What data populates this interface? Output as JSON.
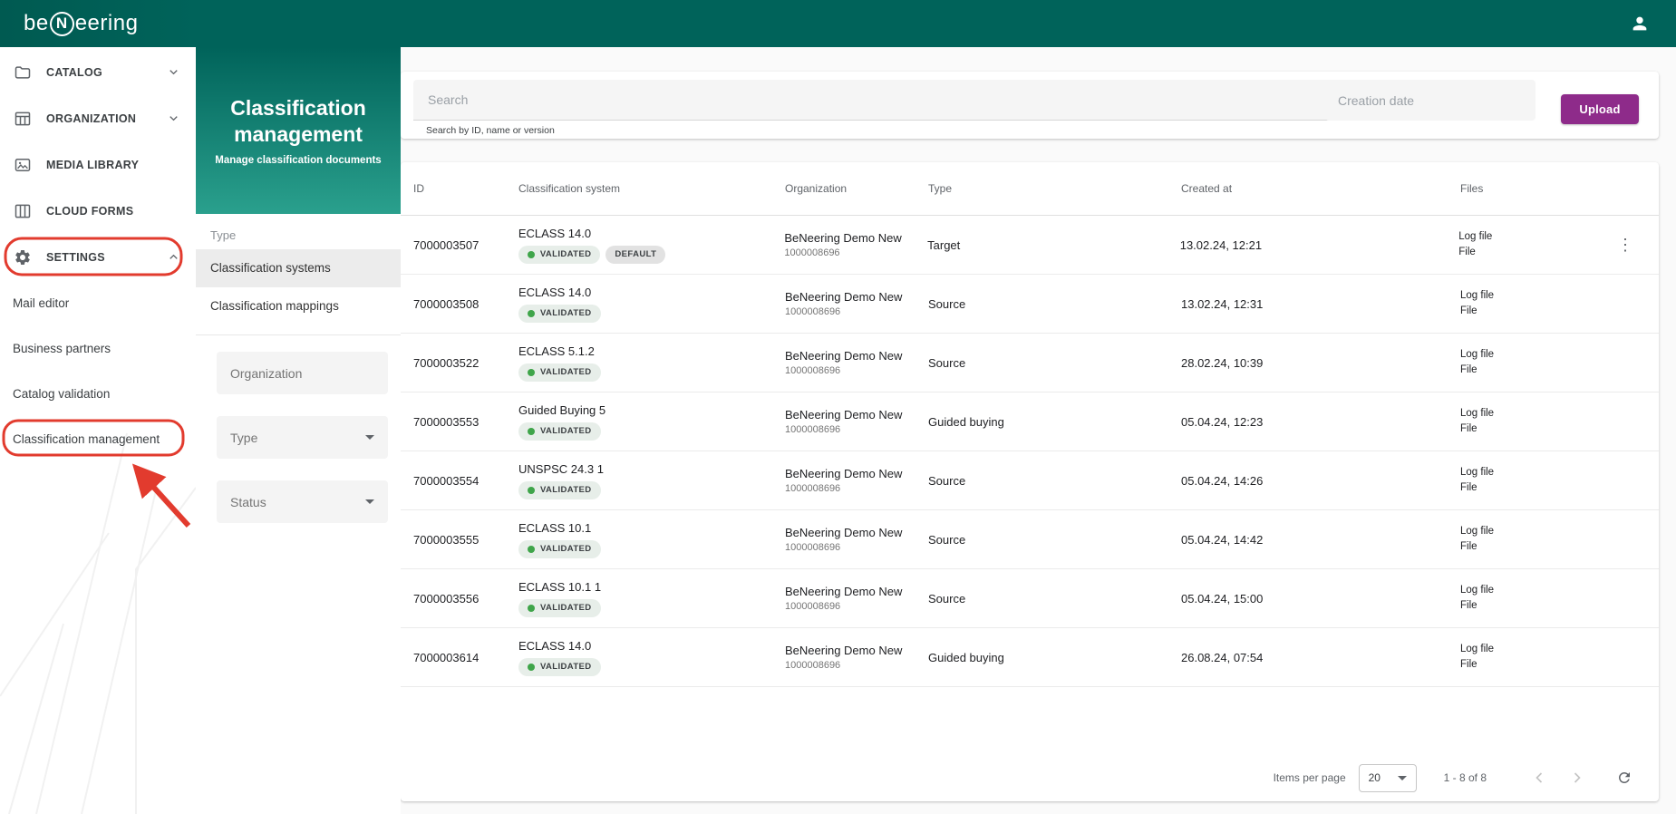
{
  "topbar": {
    "logo_prefix": "be",
    "logo_n": "N",
    "logo_suffix": "eering"
  },
  "sidebar": {
    "items": [
      {
        "label": "CATALOG"
      },
      {
        "label": "ORGANIZATION"
      },
      {
        "label": "MEDIA LIBRARY"
      },
      {
        "label": "CLOUD FORMS"
      },
      {
        "label": "SETTINGS"
      }
    ],
    "sub_items": [
      {
        "label": "Mail editor"
      },
      {
        "label": "Business partners"
      },
      {
        "label": "Catalog validation"
      },
      {
        "label": "Classification management"
      }
    ]
  },
  "panel": {
    "title": "Classification management",
    "subtitle": "Manage classification documents",
    "section_label": "Type",
    "nav": [
      {
        "label": "Classification systems"
      },
      {
        "label": "Classification mappings"
      }
    ],
    "filters": {
      "organization_label": "Organization",
      "type_label": "Type",
      "status_label": "Status"
    }
  },
  "search": {
    "placeholder": "Search",
    "hint": "Search by ID, name or version",
    "date_placeholder": "Creation date",
    "upload_label": "Upload"
  },
  "table": {
    "columns": [
      "ID",
      "Classification system",
      "Organization",
      "Type",
      "Created at",
      "Files"
    ],
    "rows": [
      {
        "id": "7000003507",
        "system": "ECLASS 14.0",
        "badges": [
          "VALIDATED",
          "DEFAULT"
        ],
        "org": "BeNeering Demo New",
        "org_id": "1000008696",
        "type": "Target",
        "created": "13.02.24, 12:21",
        "files": [
          "Log file",
          "File"
        ]
      },
      {
        "id": "7000003508",
        "system": "ECLASS 14.0",
        "badges": [
          "VALIDATED"
        ],
        "org": "BeNeering Demo New",
        "org_id": "1000008696",
        "type": "Source",
        "created": "13.02.24, 12:31",
        "files": [
          "Log file",
          "File"
        ]
      },
      {
        "id": "7000003522",
        "system": "ECLASS 5.1.2",
        "badges": [
          "VALIDATED"
        ],
        "org": "BeNeering Demo New",
        "org_id": "1000008696",
        "type": "Source",
        "created": "28.02.24, 10:39",
        "files": [
          "Log file",
          "File"
        ]
      },
      {
        "id": "7000003553",
        "system": "Guided Buying 5",
        "badges": [
          "VALIDATED"
        ],
        "org": "BeNeering Demo New",
        "org_id": "1000008696",
        "type": "Guided buying",
        "created": "05.04.24, 12:23",
        "files": [
          "Log file",
          "File"
        ]
      },
      {
        "id": "7000003554",
        "system": "UNSPSC 24.3 1",
        "badges": [
          "VALIDATED"
        ],
        "org": "BeNeering Demo New",
        "org_id": "1000008696",
        "type": "Source",
        "created": "05.04.24, 14:26",
        "files": [
          "Log file",
          "File"
        ]
      },
      {
        "id": "7000003555",
        "system": "ECLASS 10.1",
        "badges": [
          "VALIDATED"
        ],
        "org": "BeNeering Demo New",
        "org_id": "1000008696",
        "type": "Source",
        "created": "05.04.24, 14:42",
        "files": [
          "Log file",
          "File"
        ]
      },
      {
        "id": "7000003556",
        "system": "ECLASS 10.1 1",
        "badges": [
          "VALIDATED"
        ],
        "org": "BeNeering Demo New",
        "org_id": "1000008696",
        "type": "Source",
        "created": "05.04.24, 15:00",
        "files": [
          "Log file",
          "File"
        ]
      },
      {
        "id": "7000003614",
        "system": "ECLASS 14.0",
        "badges": [
          "VALIDATED"
        ],
        "org": "BeNeering Demo New",
        "org_id": "1000008696",
        "type": "Guided buying",
        "created": "26.08.24, 07:54",
        "files": [
          "Log file",
          "File"
        ]
      }
    ]
  },
  "pagination": {
    "items_per_page_label": "Items per page",
    "page_size": "20",
    "range": "1 - 8 of 8"
  }
}
